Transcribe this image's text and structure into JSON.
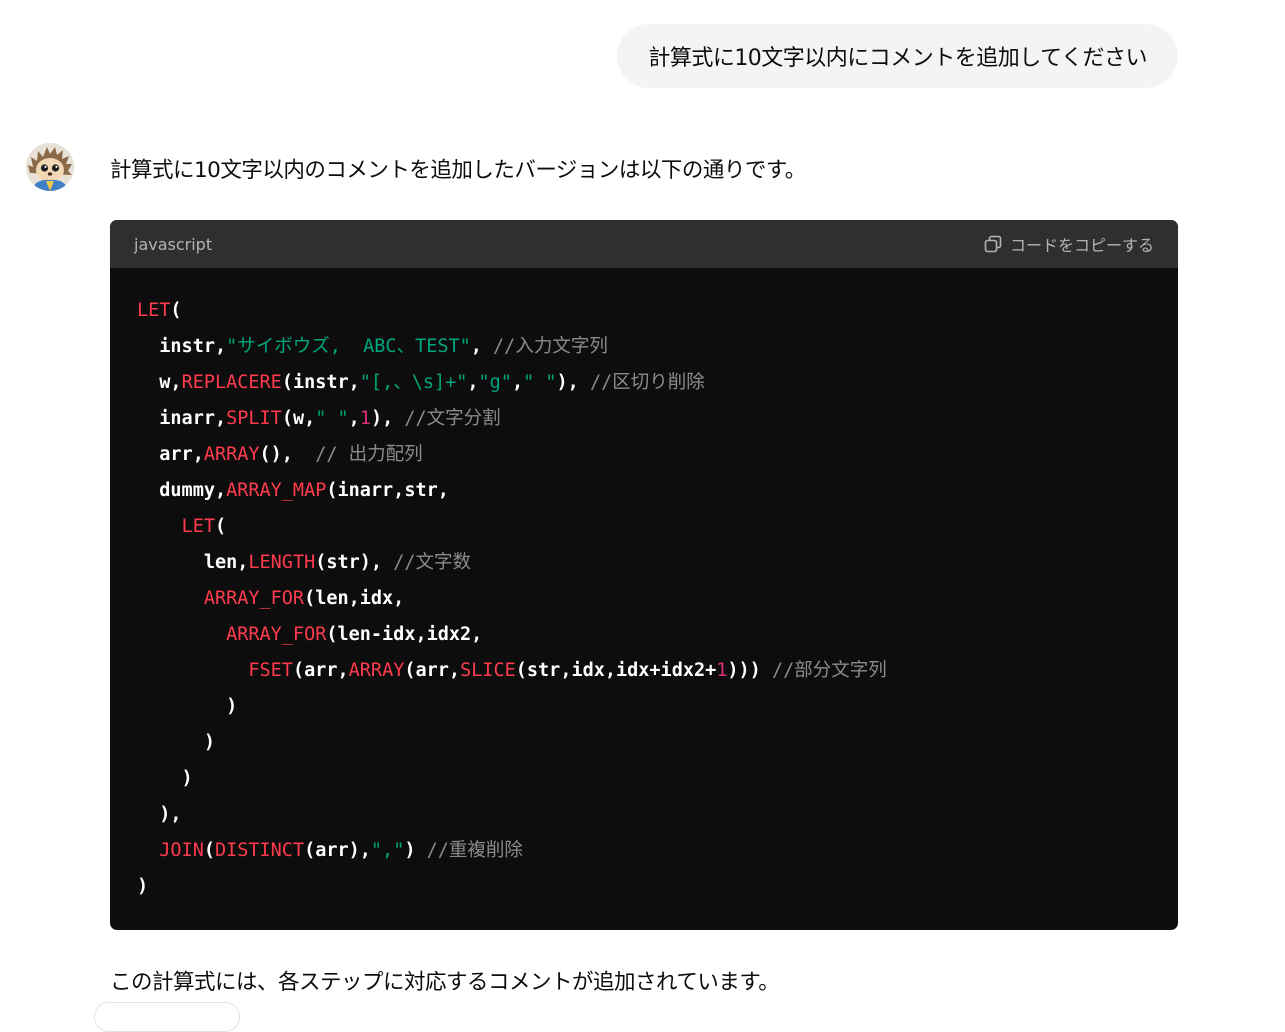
{
  "user_message": {
    "text": "計算式に10文字以内にコメントを追加してください"
  },
  "assistant": {
    "intro": "計算式に10文字以内のコメントを追加したバージョンは以下の通りです。",
    "code_block": {
      "language": "javascript",
      "copy_label": "コードをコピーする",
      "lines": [
        [
          [
            "kw",
            "LET"
          ],
          [
            "p",
            "("
          ]
        ],
        [
          [
            "p",
            "  instr,"
          ],
          [
            "str",
            "\"サイボウズ,  ABC、TEST\""
          ],
          [
            "p",
            ", "
          ],
          [
            "cm",
            "//入力文字列"
          ]
        ],
        [
          [
            "p",
            "  w,"
          ],
          [
            "kw",
            "REPLACERE"
          ],
          [
            "p",
            "(instr,"
          ],
          [
            "str",
            "\"[,、\\s]+\""
          ],
          [
            "p",
            ","
          ],
          [
            "str",
            "\"g\""
          ],
          [
            "p",
            ","
          ],
          [
            "str",
            "\" \""
          ],
          [
            "p",
            "), "
          ],
          [
            "cm",
            "//区切り削除"
          ]
        ],
        [
          [
            "p",
            "  inarr,"
          ],
          [
            "kw",
            "SPLIT"
          ],
          [
            "p",
            "(w,"
          ],
          [
            "str",
            "\" \""
          ],
          [
            "p",
            ","
          ],
          [
            "num",
            "1"
          ],
          [
            "p",
            "), "
          ],
          [
            "cm",
            "//文字分割"
          ]
        ],
        [
          [
            "p",
            "  arr,"
          ],
          [
            "kw",
            "ARRAY"
          ],
          [
            "p",
            "(),  "
          ],
          [
            "cm",
            "// 出力配列"
          ]
        ],
        [
          [
            "p",
            "  dummy,"
          ],
          [
            "kw",
            "ARRAY_MAP"
          ],
          [
            "p",
            "(inarr,str,"
          ]
        ],
        [
          [
            "p",
            "    "
          ],
          [
            "kw",
            "LET"
          ],
          [
            "p",
            "("
          ]
        ],
        [
          [
            "p",
            "      len,"
          ],
          [
            "kw",
            "LENGTH"
          ],
          [
            "p",
            "(str), "
          ],
          [
            "cm",
            "//文字数"
          ]
        ],
        [
          [
            "p",
            "      "
          ],
          [
            "kw",
            "ARRAY_FOR"
          ],
          [
            "p",
            "(len,idx,"
          ]
        ],
        [
          [
            "p",
            "        "
          ],
          [
            "kw",
            "ARRAY_FOR"
          ],
          [
            "p",
            "(len-idx,idx2,"
          ]
        ],
        [
          [
            "p",
            "          "
          ],
          [
            "kw",
            "FSET"
          ],
          [
            "p",
            "(arr,"
          ],
          [
            "kw",
            "ARRAY"
          ],
          [
            "p",
            "(arr,"
          ],
          [
            "kw",
            "SLICE"
          ],
          [
            "p",
            "(str,idx,idx+idx2+"
          ],
          [
            "num",
            "1"
          ],
          [
            "p",
            "))) "
          ],
          [
            "cm",
            "//部分文字列"
          ]
        ],
        [
          [
            "p",
            "        )"
          ]
        ],
        [
          [
            "p",
            "      )"
          ]
        ],
        [
          [
            "p",
            "    )"
          ]
        ],
        [
          [
            "p",
            "  ),"
          ]
        ],
        [
          [
            "p",
            "  "
          ],
          [
            "kw",
            "JOIN"
          ],
          [
            "p",
            "("
          ],
          [
            "kw",
            "DISTINCT"
          ],
          [
            "p",
            "(arr),"
          ],
          [
            "str",
            "\",\""
          ],
          [
            "p",
            ") "
          ],
          [
            "cm",
            "//重複削除"
          ]
        ],
        [
          [
            "p",
            ")"
          ]
        ]
      ]
    },
    "outro": "この計算式には、各ステップに対応するコメントが追加されています。"
  },
  "colors": {
    "keyword": "#ff3b4e",
    "string": "#00a67d",
    "number": "#df3079",
    "comment": "#8b8b8b",
    "code_bg": "#0d0d0d",
    "code_header_bg": "#2f2f2f",
    "user_bubble_bg": "#f4f4f4"
  },
  "icons": {
    "copy": "copy-icon",
    "avatar": "hedgehog-avatar"
  }
}
